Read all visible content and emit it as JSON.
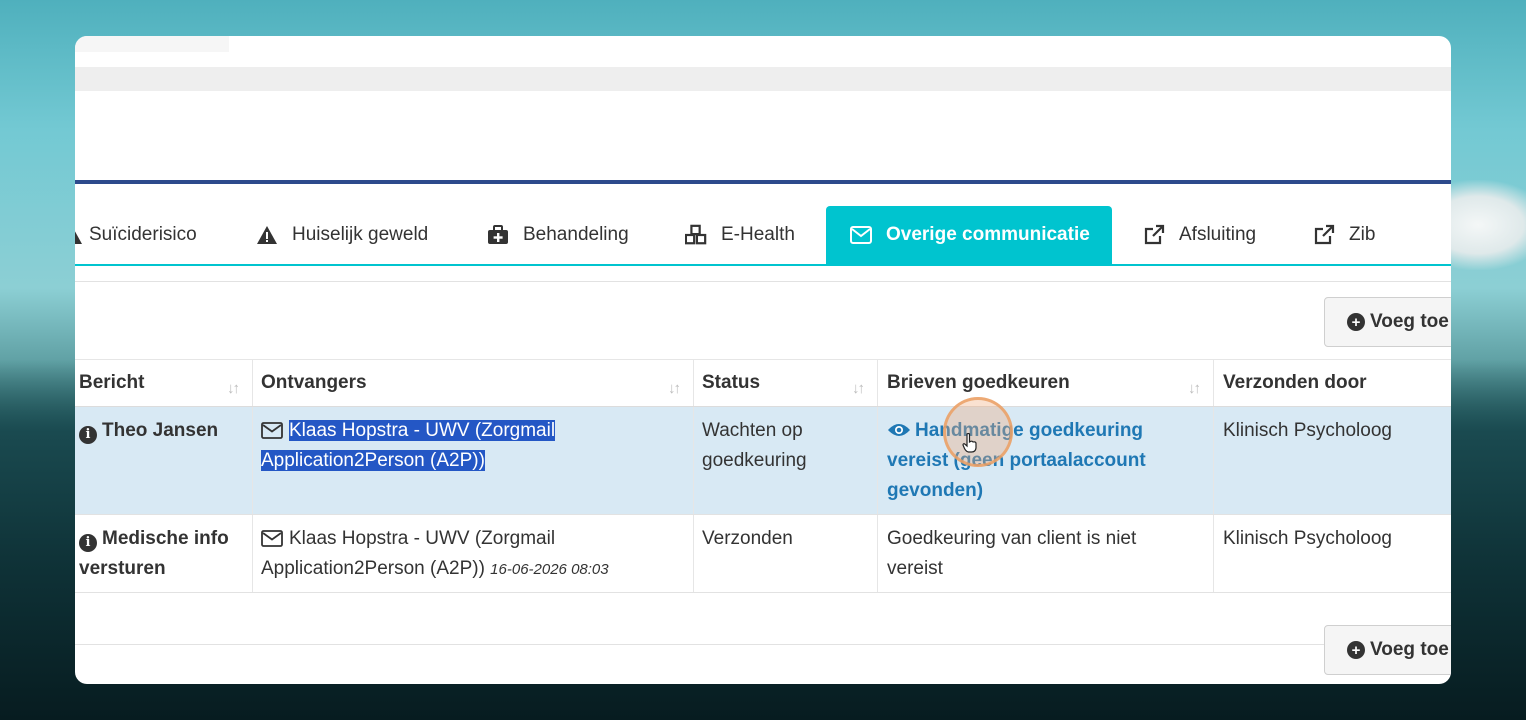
{
  "tabs": [
    {
      "label": "Suïciderisico",
      "icon": "warning-icon"
    },
    {
      "label": "Huiselijk geweld",
      "icon": "warning-icon"
    },
    {
      "label": "Behandeling",
      "icon": "medkit-icon"
    },
    {
      "label": "E-Health",
      "icon": "cubes-icon"
    },
    {
      "label": "Overige communicatie",
      "icon": "envelope-icon",
      "active": true
    },
    {
      "label": "Afsluiting",
      "icon": "external-link-icon"
    },
    {
      "label": "Zib",
      "icon": "external-link-icon"
    }
  ],
  "add_button_label": "Voeg toe",
  "table": {
    "headers": [
      "Bericht",
      "Ontvangers",
      "Status",
      "Brieven goedkeuren",
      "Verzonden door"
    ],
    "rows": [
      {
        "bericht": "Theo Jansen",
        "ontvangers_line1": "Klaas Hopstra - UWV (Zorgmail",
        "ontvangers_line2": "Application2Person (A2P))",
        "ontvangers_date": "",
        "status_line1": "Wachten op",
        "status_line2": "goedkeuring",
        "goedkeuren_line1": "Handmatige goedkeuring",
        "goedkeuren_line2": "vereist (geen portaalaccount",
        "goedkeuren_line3": "gevonden)",
        "verzonden_door": "Klinisch Psycholoog"
      },
      {
        "bericht_line1": "Medische info",
        "bericht_line2": "versturen",
        "ontvangers_line1": "Klaas Hopstra - UWV (Zorgmail",
        "ontvangers_line2": "Application2Person (A2P))",
        "ontvangers_date": "16-06-2026 08:03",
        "status": "Verzonden",
        "goedkeuren_line1": "Goedkeuring van client is niet",
        "goedkeuren_line2": "vereist",
        "verzonden_door": "Klinisch Psycholoog"
      }
    ]
  },
  "colors": {
    "accent": "#00c4cf",
    "selection": "#2457c5",
    "link": "#1f78b4",
    "highlight_row": "#d8e9f4"
  }
}
